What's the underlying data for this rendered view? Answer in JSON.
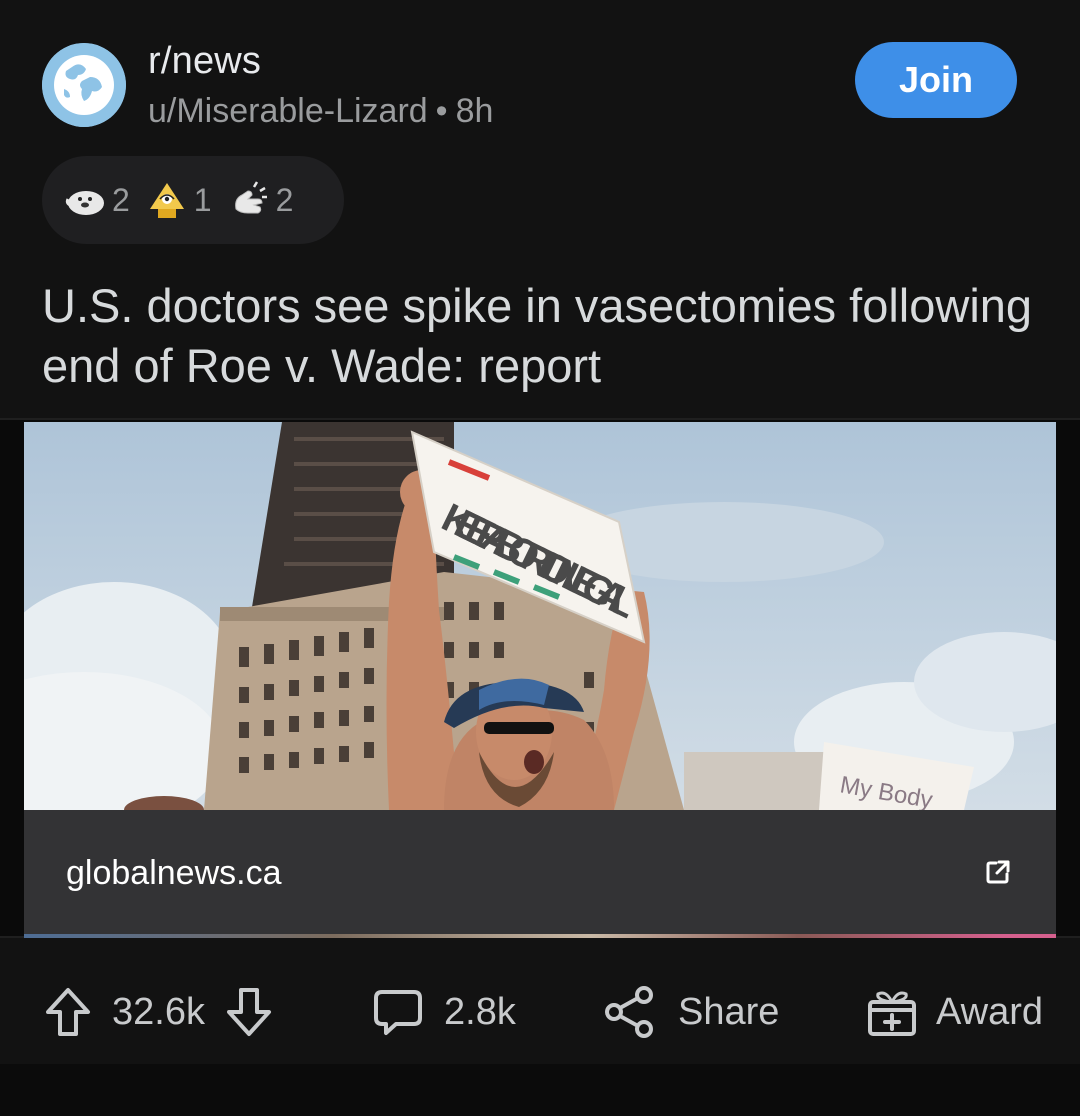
{
  "header": {
    "subreddit": "r/news",
    "author": "u/Miserable-Lizard",
    "separator": "•",
    "age": "8h",
    "join_label": "Join",
    "avatar_icon": "globe-icon"
  },
  "awards": [
    {
      "icon": "helpful-seal-icon",
      "count": "2"
    },
    {
      "icon": "wholesome-award-icon",
      "count": "1"
    },
    {
      "icon": "take-my-energy-icon",
      "count": "2"
    }
  ],
  "post": {
    "title": "U.S. doctors see spike in vasectomies following end of Roe v. Wade: report"
  },
  "link_card": {
    "domain": "globalnews.ca",
    "image_sign_text": "KEEP ABORTION LEGAL",
    "image_sign2_text": "My Body",
    "external_icon": "external-link-icon"
  },
  "actions": {
    "upvotes": "32.6k",
    "comments": "2.8k",
    "share_label": "Share",
    "award_label": "Award"
  },
  "colors": {
    "background": "#121212",
    "join": "#3e8fe8",
    "text": "#d7dadc",
    "muted": "#9a9c9e"
  }
}
